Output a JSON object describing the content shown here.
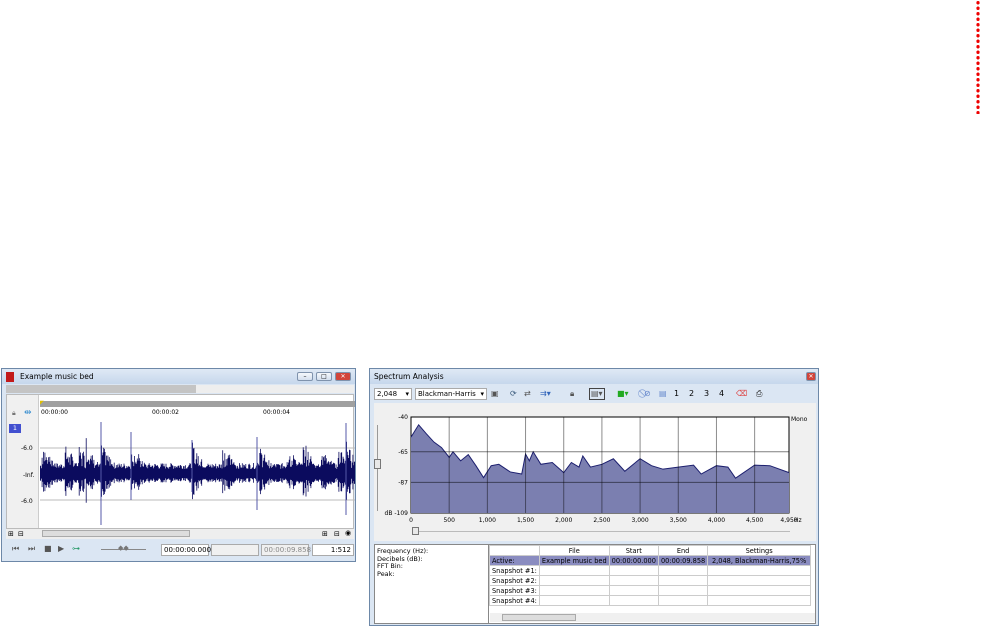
{
  "wave_window": {
    "title": "Example music bed",
    "ruler": [
      "00:00:00",
      "00:00:02",
      "00:00:04"
    ],
    "channel": "1",
    "db_labels": [
      "-6.0",
      "-Inf.",
      "-6.0"
    ],
    "selection_start": "00:00:00.000",
    "selection_end": "",
    "length": "00:00:09.858",
    "zoom": "1:512"
  },
  "spectrum_window": {
    "title": "Spectrum Analysis",
    "fft_size": "2,048",
    "window_type": "Blackman-Harris",
    "snapshots": [
      "1",
      "2",
      "3",
      "4"
    ],
    "channel_label": "Mono",
    "info_labels": [
      "Frequency (Hz):",
      "Decibels (dB):",
      "FFT Bin:",
      "Peak:"
    ],
    "table": {
      "headers": [
        "",
        "File",
        "Start",
        "End",
        "Settings"
      ],
      "rows": [
        [
          "Active:",
          "Example music bed",
          "00:00:00.000",
          "00:00:09.858",
          "2,048, Blackman-Harris,75%"
        ],
        [
          "Snapshot #1:",
          "",
          "",
          "",
          ""
        ],
        [
          "Snapshot #2:",
          "",
          "",
          "",
          ""
        ],
        [
          "Snapshot #3:",
          "",
          "",
          "",
          ""
        ],
        [
          "Snapshot #4:",
          "",
          "",
          "",
          ""
        ]
      ]
    }
  },
  "chart_data": {
    "type": "area",
    "title": "",
    "xlabel": "Hz",
    "ylabel": "dB",
    "xlim": [
      0,
      4950
    ],
    "ylim": [
      -109,
      -40
    ],
    "x_ticks": [
      "0",
      "500",
      "1,000",
      "1,500",
      "2,000",
      "2,500",
      "3,000",
      "3,500",
      "4,000",
      "4,500",
      "4,950"
    ],
    "y_ticks": [
      "-40",
      "-65",
      "-87",
      "dB -109"
    ],
    "x": [
      0,
      100,
      200,
      300,
      400,
      500,
      550,
      650,
      750,
      850,
      950,
      1050,
      1150,
      1300,
      1450,
      1500,
      1550,
      1600,
      1700,
      1850,
      2000,
      2100,
      2200,
      2250,
      2350,
      2500,
      2650,
      2800,
      3000,
      3150,
      3300,
      3500,
      3700,
      3800,
      4000,
      4150,
      4250,
      4500,
      4700,
      4950
    ],
    "y": [
      -54.5,
      -45.6,
      -52,
      -58,
      -62,
      -69,
      -65,
      -71.5,
      -67,
      -75,
      -83.6,
      -75,
      -74,
      -79.5,
      -81,
      -66.6,
      -71.5,
      -65,
      -74,
      -72.7,
      -80,
      -72.7,
      -76,
      -68,
      -76,
      -74,
      -70,
      -79,
      -70,
      -75,
      -77.5,
      -76,
      -74.6,
      -81,
      -75,
      -76,
      -84,
      -74.6,
      -75,
      -80
    ],
    "fill": "#7b7fb0",
    "line": "#1c1f6e"
  }
}
